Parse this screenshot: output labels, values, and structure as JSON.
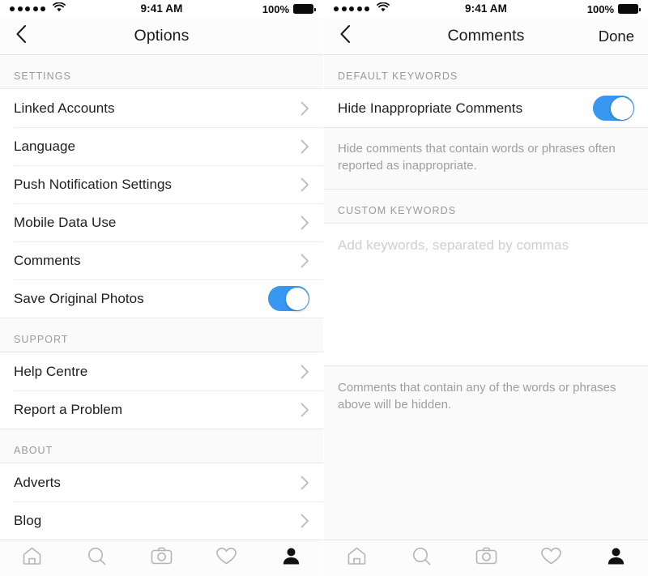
{
  "status_bar": {
    "signal_dots": 5,
    "wifi_icon": "wifi-icon",
    "time": "9:41 AM",
    "battery_percent": "100%",
    "battery_icon": "battery-full-icon"
  },
  "colors": {
    "toggle_on": "#3897F0",
    "section_bg": "#FAFAFA",
    "row_bg": "#FFFFFF",
    "divider": "#ECECEC",
    "label_text": "#202020",
    "muted_text": "#9E9E9E",
    "placeholder_text": "#CFCFCF"
  },
  "left_screen": {
    "nav": {
      "back_icon": "chevron-left-icon",
      "title": "Options"
    },
    "sections": [
      {
        "header": "SETTINGS",
        "rows": [
          {
            "label": "Linked Accounts",
            "accessory": "chevron"
          },
          {
            "label": "Language",
            "accessory": "chevron"
          },
          {
            "label": "Push Notification Settings",
            "accessory": "chevron"
          },
          {
            "label": "Mobile Data Use",
            "accessory": "chevron"
          },
          {
            "label": "Comments",
            "accessory": "chevron"
          },
          {
            "label": "Save Original Photos",
            "accessory": "toggle",
            "toggle_on": true
          }
        ]
      },
      {
        "header": "SUPPORT",
        "rows": [
          {
            "label": "Help Centre",
            "accessory": "chevron"
          },
          {
            "label": "Report a Problem",
            "accessory": "chevron"
          }
        ]
      },
      {
        "header": "ABOUT",
        "rows": [
          {
            "label": "Adverts",
            "accessory": "chevron"
          },
          {
            "label": "Blog",
            "accessory": "chevron"
          }
        ]
      }
    ]
  },
  "right_screen": {
    "nav": {
      "back_icon": "chevron-left-icon",
      "title": "Comments",
      "action_label": "Done"
    },
    "default_keywords": {
      "header": "DEFAULT KEYWORDS",
      "row_label": "Hide Inappropriate Comments",
      "toggle_on": true,
      "description": "Hide comments that contain words or phrases often reported as inappropriate."
    },
    "custom_keywords": {
      "header": "CUSTOM KEYWORDS",
      "input_value": "",
      "input_placeholder": "Add keywords, separated by commas",
      "footer_note": "Comments that contain any of the words or phrases above will be hidden."
    }
  },
  "tab_bar": {
    "tabs": [
      {
        "name": "home-icon",
        "label": "Home",
        "active": false
      },
      {
        "name": "search-icon",
        "label": "Search",
        "active": false
      },
      {
        "name": "camera-icon",
        "label": "Camera",
        "active": false
      },
      {
        "name": "heart-icon",
        "label": "Activity",
        "active": false
      },
      {
        "name": "profile-icon",
        "label": "Profile",
        "active": true
      }
    ]
  }
}
